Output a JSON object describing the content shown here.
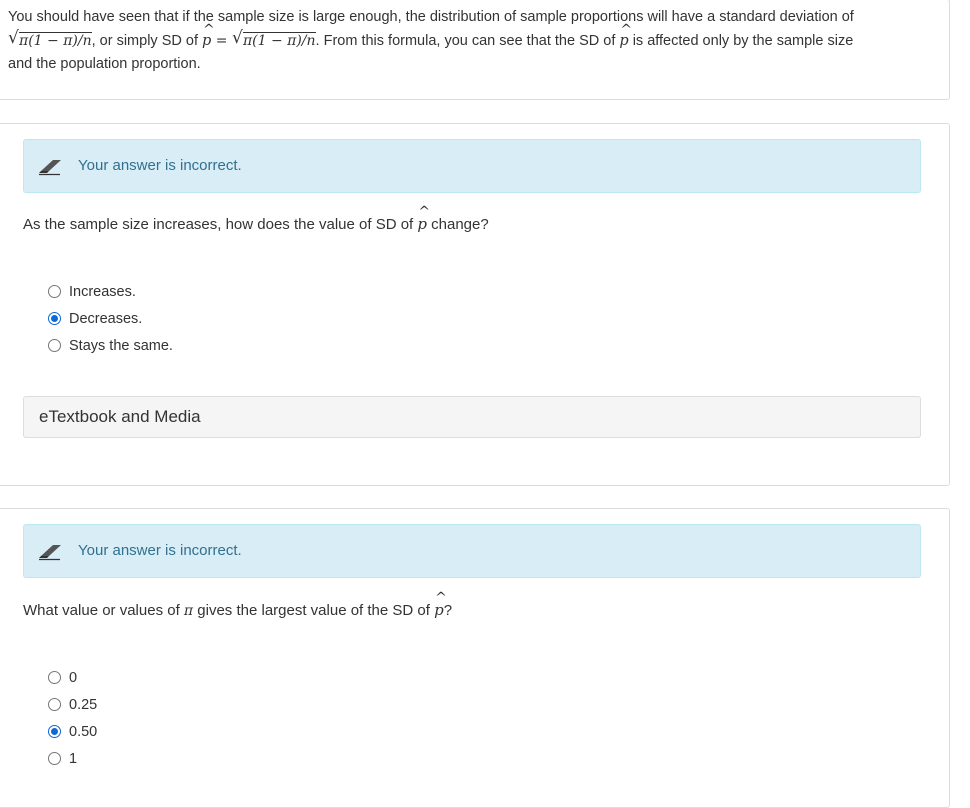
{
  "intro": {
    "line1": "You should have seen that if the sample size is large enough, the distribution of sample proportions will have a standard deviation of",
    "formula": "π(1 − π)/n",
    "text_or_simply": ", or simply SD of ",
    "equals": " = ",
    "text_from_formula": ". From this formula, you can see that the SD of ",
    "text_affected": " is affected only by the sample size",
    "line3": "and the population proportion."
  },
  "q1": {
    "feedback": "Your answer is incorrect.",
    "question_pre": "As the sample size increases, how does the value of SD of ",
    "question_post": " change?",
    "options": [
      {
        "label": "Increases.",
        "selected": false
      },
      {
        "label": "Decreases.",
        "selected": true
      },
      {
        "label": "Stays the same.",
        "selected": false
      }
    ],
    "etextbook_label": "eTextbook and Media"
  },
  "q2": {
    "feedback": "Your answer is incorrect.",
    "question_pre": "What value or values of ",
    "question_pi": "π",
    "question_mid": " gives the largest value of the SD of ",
    "question_post": "?",
    "options": [
      {
        "label": "0",
        "selected": false
      },
      {
        "label": "0.25",
        "selected": false
      },
      {
        "label": "0.50",
        "selected": true
      },
      {
        "label": "1",
        "selected": false
      }
    ]
  },
  "symbols": {
    "p": "p",
    "hat": "^",
    "radical": "√"
  },
  "colors": {
    "alert_bg": "#d9edf7",
    "alert_text": "#31708f",
    "radio_checked": "#0d69d6"
  }
}
